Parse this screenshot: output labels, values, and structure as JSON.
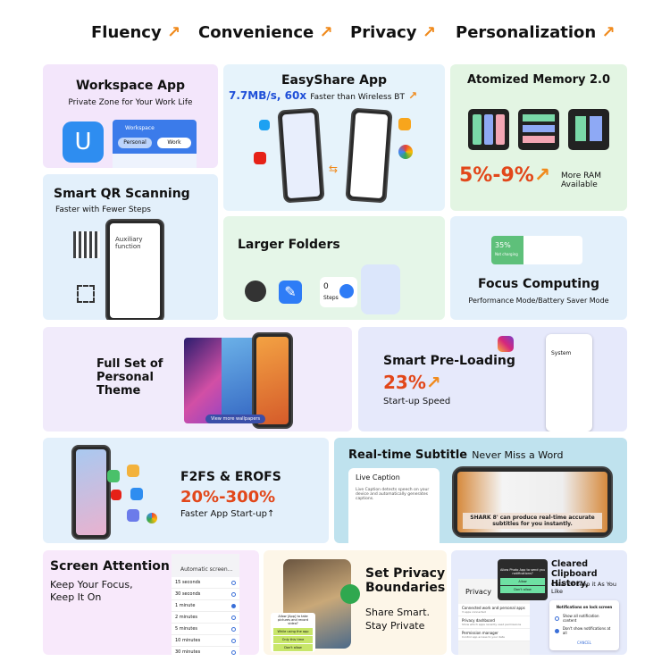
{
  "header": {
    "items": [
      {
        "label": "Fluency"
      },
      {
        "label": "Convenience"
      },
      {
        "label": "Privacy"
      },
      {
        "label": "Personalization"
      }
    ],
    "arrow_icon": "arrow-up-right-icon",
    "accent": "#f08a1c"
  },
  "workspace": {
    "title": "Workspace App",
    "subtitle": "Private Zone for Your Work Life",
    "panel_title": "Workspace",
    "tab_personal": "Personal",
    "tab_work": "Work"
  },
  "easyshare": {
    "title": "EasyShare App",
    "speed": "7.7MB/s,",
    "multiplier": "60x",
    "tail": "Faster than Wireless BT"
  },
  "atomized": {
    "title": "Atomized Memory 2.0",
    "range": "5%-9%",
    "note": "More RAM Available"
  },
  "qr": {
    "title": "Smart QR Scanning",
    "subtitle": "Faster with Fewer Steps",
    "screen_title": "Auxiliary function"
  },
  "folders": {
    "title": "Larger Folders",
    "steps_value": "0",
    "steps_label": "Steps"
  },
  "focus": {
    "title": "Focus Computing",
    "subtitle": "Performance Mode/Battery Saver Mode",
    "battery": "35%",
    "battery_note": "Not charging"
  },
  "theme": {
    "title": "Full Set of Personal Theme",
    "button": "View more wallpapers"
  },
  "preload": {
    "title": "Smart Pre-Loading",
    "value": "23%",
    "subtitle": "Start-up Speed",
    "screen_title": "System"
  },
  "f2fs": {
    "title": "F2FS & EROFS",
    "range": "20%-300%",
    "subtitle": "Faster App Start-up↑"
  },
  "subtitle": {
    "title": "Real-time Subtitle",
    "tagline": "Never Miss a Word",
    "live_title": "Live Caption",
    "live_desc": "Live Caption detects speech on your device and automatically generates captions.",
    "caption": "SHARK 8' can produce real-time accurate subtitles for you instantly."
  },
  "attention": {
    "title": "Screen Attention",
    "line1": "Keep Your Focus,",
    "line2": "Keep It On",
    "screen_title": "Automatic screen...",
    "options": [
      "15 seconds",
      "30 seconds",
      "1 minute",
      "2 minutes",
      "5 minutes",
      "10 minutes",
      "30 minutes"
    ],
    "selected": 2
  },
  "privacy": {
    "title": "Set Privacy Boundaries",
    "line1": "Share Smart.",
    "line2": "Stay Private",
    "prompt": "Allow [App] to take pictures and record video?",
    "options": [
      "While using the app",
      "Only this time",
      "Don't allow"
    ]
  },
  "clipboard": {
    "title": "Cleared Clipboard History,",
    "subtitle": "Clear or keep it As You Like",
    "privacy_label": "Privacy",
    "dialog_prompt": "Allow Photo App to send you notifications?",
    "allow": "Allow",
    "deny": "Don't allow",
    "privacy_items": [
      {
        "t": "Connected work and personal apps",
        "s": "3 apps connected"
      },
      {
        "t": "Privacy dashboard",
        "s": "Show which apps recently used permissions"
      },
      {
        "t": "Permission manager",
        "s": "Control app access to your data"
      }
    ],
    "lock_title": "Notifications on lock screen",
    "lock_opts": [
      "Show all notification content",
      "Don't show notifications at all"
    ],
    "cancel": "CANCEL"
  }
}
